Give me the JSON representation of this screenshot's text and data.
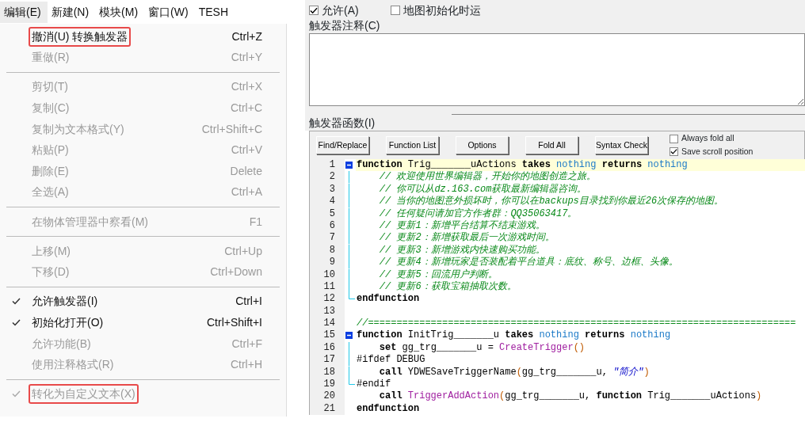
{
  "menubar": [
    {
      "label": "编辑(E)",
      "selected": true
    },
    {
      "label": "新建(N)",
      "selected": false
    },
    {
      "label": "模块(M)",
      "selected": false
    },
    {
      "label": "窗口(W)",
      "selected": false
    },
    {
      "label": "TESH",
      "selected": false
    }
  ],
  "menu": {
    "items": [
      {
        "kind": "item",
        "label": "撤消(U) 转换触发器",
        "shortcut": "Ctrl+Z",
        "enabled": true,
        "checked": false,
        "highlighted": true
      },
      {
        "kind": "item",
        "label": "重做(R)",
        "shortcut": "Ctrl+Y",
        "enabled": false,
        "checked": false,
        "highlighted": false
      },
      {
        "kind": "separator"
      },
      {
        "kind": "item",
        "label": "剪切(T)",
        "shortcut": "Ctrl+X",
        "enabled": false,
        "checked": false,
        "highlighted": false
      },
      {
        "kind": "item",
        "label": "复制(C)",
        "shortcut": "Ctrl+C",
        "enabled": false,
        "checked": false,
        "highlighted": false
      },
      {
        "kind": "item",
        "label": "复制为文本格式(Y)",
        "shortcut": "Ctrl+Shift+C",
        "enabled": false,
        "checked": false,
        "highlighted": false
      },
      {
        "kind": "item",
        "label": "粘贴(P)",
        "shortcut": "Ctrl+V",
        "enabled": false,
        "checked": false,
        "highlighted": false
      },
      {
        "kind": "item",
        "label": "删除(E)",
        "shortcut": "Delete",
        "enabled": false,
        "checked": false,
        "highlighted": false
      },
      {
        "kind": "item",
        "label": "全选(A)",
        "shortcut": "Ctrl+A",
        "enabled": false,
        "checked": false,
        "highlighted": false
      },
      {
        "kind": "separator"
      },
      {
        "kind": "item",
        "label": "在物体管理器中察看(M)",
        "shortcut": "F1",
        "enabled": false,
        "checked": false,
        "highlighted": false
      },
      {
        "kind": "separator"
      },
      {
        "kind": "item",
        "label": "上移(M)",
        "shortcut": "Ctrl+Up",
        "enabled": false,
        "checked": false,
        "highlighted": false
      },
      {
        "kind": "item",
        "label": "下移(D)",
        "shortcut": "Ctrl+Down",
        "enabled": false,
        "checked": false,
        "highlighted": false
      },
      {
        "kind": "separator"
      },
      {
        "kind": "item",
        "label": "允许触发器(I)",
        "shortcut": "Ctrl+I",
        "enabled": true,
        "checked": true,
        "highlighted": false
      },
      {
        "kind": "item",
        "label": "初始化打开(O)",
        "shortcut": "Ctrl+Shift+I",
        "enabled": true,
        "checked": true,
        "highlighted": false
      },
      {
        "kind": "item",
        "label": "允许功能(B)",
        "shortcut": "Ctrl+F",
        "enabled": false,
        "checked": false,
        "highlighted": false
      },
      {
        "kind": "item",
        "label": "使用注释格式(R)",
        "shortcut": "Ctrl+H",
        "enabled": false,
        "checked": false,
        "highlighted": false
      },
      {
        "kind": "separator"
      },
      {
        "kind": "item",
        "label": "转化为自定义文本(X)",
        "enabled": false,
        "checked": true,
        "highlighted": true
      }
    ]
  },
  "trigger": {
    "options": [
      {
        "label": "允许(A)",
        "checked": true
      },
      {
        "label": "地图初始化时运",
        "checked": false
      }
    ],
    "comment_label": "触发器注释(C)",
    "functions_label": "触发器函数(I)",
    "toolbar": {
      "buttons": [
        "Find/Replace",
        "Function List",
        "Options",
        "Fold All",
        "Syntax Check"
      ],
      "options": [
        {
          "label": "Always fold all",
          "checked": false
        },
        {
          "label": "Save scroll position",
          "checked": true
        }
      ]
    },
    "code": [
      {
        "number": "1",
        "kind": "start",
        "highlighted": true,
        "tokens": [
          {
            "kind": "kw",
            "text": "function"
          },
          {
            "kind": "plain",
            "text": " Trig_______uActions "
          },
          {
            "kind": "kw",
            "text": "takes "
          },
          {
            "kind": "type",
            "text": "nothing"
          },
          {
            "kind": "kw",
            "text": " returns "
          },
          {
            "kind": "type",
            "text": "nothing"
          }
        ]
      },
      {
        "number": "2",
        "kind": "body",
        "highlighted": false,
        "tokens": [
          {
            "kind": "comment",
            "text": "    // 欢迎使用世界编辑器，开始你的地图创造之旅。"
          }
        ]
      },
      {
        "number": "3",
        "kind": "body",
        "highlighted": false,
        "tokens": [
          {
            "kind": "comment",
            "text": "    // 你可以从dz.163.com获取最新编辑器咨询。"
          }
        ]
      },
      {
        "number": "4",
        "kind": "body",
        "highlighted": false,
        "tokens": [
          {
            "kind": "comment",
            "text": "    // 当你的地图意外损坏时，你可以在backups目录找到你最近26次保存的地图。"
          }
        ]
      },
      {
        "number": "5",
        "kind": "body",
        "highlighted": false,
        "tokens": [
          {
            "kind": "comment",
            "text": "    // 任何疑问请加官方作者群：QQ35063417。"
          }
        ]
      },
      {
        "number": "6",
        "kind": "body",
        "highlighted": false,
        "tokens": [
          {
            "kind": "comment",
            "text": "    // 更新1：新增平台结算不结束游戏。"
          }
        ]
      },
      {
        "number": "7",
        "kind": "body",
        "highlighted": false,
        "tokens": [
          {
            "kind": "comment",
            "text": "    // 更新2：新增获取最后一次游戏时间。"
          }
        ]
      },
      {
        "number": "8",
        "kind": "body",
        "highlighted": false,
        "tokens": [
          {
            "kind": "comment",
            "text": "    // 更新3：新增游戏内快速购买功能。"
          }
        ]
      },
      {
        "number": "9",
        "kind": "body",
        "highlighted": false,
        "tokens": [
          {
            "kind": "comment",
            "text": "    // 更新4：新增玩家是否装配着平台道具：底纹、称号、边框、头像。"
          }
        ]
      },
      {
        "number": "10",
        "kind": "body",
        "highlighted": false,
        "tokens": [
          {
            "kind": "comment",
            "text": "    // 更新5：回流用户判断。"
          }
        ]
      },
      {
        "number": "11",
        "kind": "body",
        "highlighted": false,
        "tokens": [
          {
            "kind": "comment",
            "text": "    // 更新6：获取宝箱抽取次数。"
          }
        ]
      },
      {
        "number": "12",
        "kind": "end",
        "highlighted": false,
        "tokens": [
          {
            "kind": "kw",
            "text": "endfunction"
          }
        ]
      },
      {
        "number": "13",
        "kind": "plain"
      },
      {
        "number": "14",
        "kind": "plain",
        "highlighted": false,
        "tokens": [
          {
            "kind": "comment",
            "text": "//==========================================================================="
          }
        ]
      },
      {
        "number": "15",
        "kind": "start",
        "highlighted": false,
        "tokens": [
          {
            "kind": "kw",
            "text": "function"
          },
          {
            "kind": "plain",
            "text": " InitTrig_______u "
          },
          {
            "kind": "kw",
            "text": "takes "
          },
          {
            "kind": "type",
            "text": "nothing"
          },
          {
            "kind": "kw",
            "text": " returns "
          },
          {
            "kind": "type",
            "text": "nothing"
          }
        ]
      },
      {
        "number": "16",
        "kind": "body",
        "highlighted": false,
        "tokens": [
          {
            "kind": "kw",
            "text": "    set"
          },
          {
            "kind": "plain",
            "text": " gg_trg_______u = "
          },
          {
            "kind": "native",
            "text": "CreateTrigger"
          },
          {
            "kind": "paren",
            "text": "()"
          }
        ]
      },
      {
        "number": "17",
        "kind": "body",
        "highlighted": false,
        "tokens": [
          {
            "kind": "plain",
            "text": "#ifdef DEBUG"
          }
        ]
      },
      {
        "number": "18",
        "kind": "body",
        "highlighted": false,
        "tokens": [
          {
            "kind": "kw",
            "text": "    call"
          },
          {
            "kind": "plain",
            "text": " YDWESaveTriggerName"
          },
          {
            "kind": "paren",
            "text": "("
          },
          {
            "kind": "plain",
            "text": "gg_trg_______u, "
          },
          {
            "kind": "string",
            "text": "\"简介\""
          },
          {
            "kind": "paren",
            "text": ")"
          }
        ]
      },
      {
        "number": "19",
        "kind": "end",
        "highlighted": false,
        "tokens": [
          {
            "kind": "plain",
            "text": "#endif"
          }
        ]
      },
      {
        "number": "20",
        "kind": "plain",
        "highlighted": false,
        "tokens": [
          {
            "kind": "kw",
            "text": "    call "
          },
          {
            "kind": "native",
            "text": "TriggerAddAction"
          },
          {
            "kind": "paren",
            "text": "("
          },
          {
            "kind": "plain",
            "text": "gg_trg_______u, "
          },
          {
            "kind": "kw",
            "text": "function"
          },
          {
            "kind": "plain",
            "text": " Trig_______uActions"
          },
          {
            "kind": "paren",
            "text": ")"
          }
        ]
      },
      {
        "number": "21",
        "kind": "plain",
        "highlighted": false,
        "tokens": [
          {
            "kind": "kw",
            "text": "endfunction"
          }
        ]
      }
    ]
  }
}
